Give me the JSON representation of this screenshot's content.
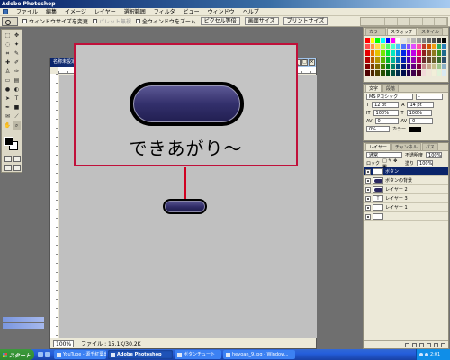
{
  "app": {
    "title": "Adobe Photoshop"
  },
  "menu": [
    "ファイル",
    "編集",
    "イメージ",
    "レイヤー",
    "選択範囲",
    "フィルタ",
    "ビュー",
    "ウィンドウ",
    "ヘルプ"
  ],
  "options": {
    "fit_window": "ウィンドウサイズを変更",
    "ignore_palettes": "パレット無視",
    "all_windows": "全ウィンドウをズーム",
    "actual_pixels": "ピクセル等倍",
    "fit_screen": "画面サイズ",
    "print_size": "プリントサイズ"
  },
  "document": {
    "title": "名称未設定",
    "zoom": "100%",
    "file_info": "ファイル : 15.1K/30.2K"
  },
  "callout": {
    "caption": "できあがり～"
  },
  "swatch_colors": [
    "#ff0000",
    "#ffff00",
    "#00ff00",
    "#00ffff",
    "#0000ff",
    "#ff00ff",
    "#ffffff",
    "#e6e6e6",
    "#cccccc",
    "#b3b3b3",
    "#999999",
    "#808080",
    "#666666",
    "#4d4d4d",
    "#333333",
    "#000000",
    "#ff4d4d",
    "#ff944d",
    "#ffdb4d",
    "#b8ff4d",
    "#4dff6e",
    "#4dffd1",
    "#4dc4ff",
    "#4d71ff",
    "#8a4dff",
    "#e04dff",
    "#ff4da6",
    "#c0392b",
    "#d35400",
    "#f39c12",
    "#27ae60",
    "#2980b9",
    "#e60000",
    "#e67300",
    "#e6c000",
    "#73e600",
    "#00e639",
    "#00e6c0",
    "#008ae6",
    "#0026e6",
    "#5a00e6",
    "#c000e6",
    "#e60073",
    "#8e1e1e",
    "#8e4d1e",
    "#8e7a1e",
    "#3f8e1e",
    "#1e6a8e",
    "#b30000",
    "#b35900",
    "#b39500",
    "#59b300",
    "#00b32c",
    "#00b395",
    "#006bb3",
    "#001db3",
    "#4600b3",
    "#9500b3",
    "#b30059",
    "#6b2d2d",
    "#6b4a2d",
    "#6b612d",
    "#3a6b2d",
    "#2d4f6b",
    "#800000",
    "#804000",
    "#806a00",
    "#408000",
    "#008020",
    "#00806a",
    "#004d80",
    "#001580",
    "#320080",
    "#6a0080",
    "#800040",
    "#c68c8c",
    "#c6a88c",
    "#c6bd8c",
    "#9ec68c",
    "#8cb0c6",
    "#4d0000",
    "#4d2600",
    "#4d4000",
    "#264d00",
    "#004d13",
    "#004d40",
    "#002e4d",
    "#000d4d",
    "#1e004d",
    "#40004d",
    "#4d0026",
    "#f2d9d9",
    "#f2e6d9",
    "#f2efd9",
    "#e0f2d9",
    "#d9e9f2"
  ],
  "character_panel": {
    "tabs": [
      "文字",
      "段落"
    ],
    "font": "MS Pゴシック",
    "style": "-",
    "size": "12 pt",
    "leading": "14 pt",
    "tracking_a": "100%",
    "tracking_b": "100%",
    "kerning": "0",
    "vscale": "0",
    "baseline": "0%",
    "color": "-"
  },
  "layers_panel": {
    "tabs": [
      "レイヤー",
      "チャンネル",
      "パス"
    ],
    "blend": "通常",
    "opacity_label": "不透明度",
    "opacity": "100%",
    "lock_label": "ロック",
    "fill_label": "塗り",
    "fill": "100%",
    "layers": [
      {
        "name": "ボタン",
        "thumb": "text",
        "selected": true
      },
      {
        "name": "ボタンの背景",
        "thumb": "dark",
        "selected": false
      },
      {
        "name": "レイヤー 2",
        "thumb": "dark",
        "selected": false
      },
      {
        "name": "レイヤー 3",
        "thumb": "text",
        "selected": false
      },
      {
        "name": "レイヤー 1",
        "thumb": "blank",
        "selected": false
      },
      {
        "name": "",
        "thumb": "blank",
        "selected": false
      }
    ]
  },
  "taskbar": {
    "start": "スタート",
    "tasks": [
      {
        "label": "YouTube - 源千紅葉出1",
        "active": false
      },
      {
        "label": "Adobe Photoshop",
        "active": true
      },
      {
        "label": "ボタンチュート",
        "active": false
      },
      {
        "label": "heyoan_9.jpg - Window...",
        "active": false
      }
    ],
    "clock": "2:01"
  }
}
